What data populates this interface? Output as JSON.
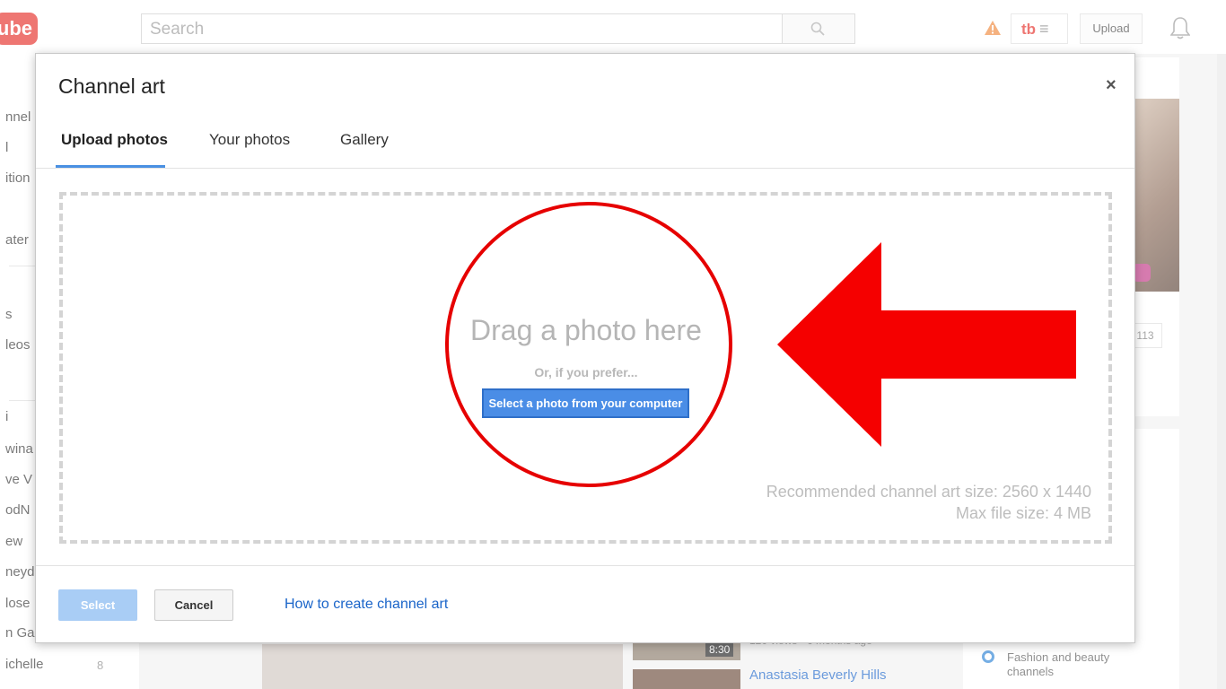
{
  "header": {
    "logo_text": "ube",
    "search_placeholder": "Search",
    "tb_label": "tb",
    "upload_label": "Upload"
  },
  "left_nav": {
    "items": [
      "nnel",
      "l",
      "ition",
      "ater",
      "s",
      "leos",
      "i",
      "wina",
      "ve V",
      "odN",
      "ew",
      "neyd",
      "lose",
      "n Ga",
      "ichelle"
    ],
    "last_count": "8"
  },
  "right_panel": {
    "count": "113",
    "fashion_text": "Fashion and beauty channels"
  },
  "videos": {
    "duration": "8:30",
    "meta": "120 views · 6 months ago",
    "title2": "Anastasia Beverly Hills"
  },
  "dialog": {
    "title": "Channel art",
    "close_label": "×",
    "tabs": [
      "Upload photos",
      "Your photos",
      "Gallery"
    ],
    "active_tab": "Upload photos",
    "drag_text": "Drag a photo here",
    "prefer_text": "Or, if you prefer...",
    "select_photo_label": "Select a photo from your computer",
    "recommended_size": "Recommended channel art size: 2560 x 1440",
    "max_file_size": "Max file size: 4 MB",
    "select_label": "Select",
    "cancel_label": "Cancel",
    "help_link": "How to create channel art"
  },
  "colors": {
    "accent_blue": "#4a8de6",
    "annotation_red": "#e60000",
    "brand_red": "#e52d27"
  }
}
